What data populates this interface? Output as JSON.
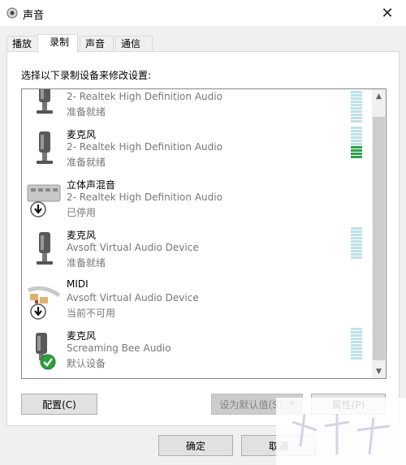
{
  "window": {
    "title": "声音",
    "close_glyph": "✕"
  },
  "tabs": [
    {
      "label": "播放",
      "active": false
    },
    {
      "label": "录制",
      "active": true
    },
    {
      "label": "声音",
      "active": false
    },
    {
      "label": "通信",
      "active": false
    }
  ],
  "instruction": "选择以下录制设备来修改设置:",
  "devices": [
    {
      "name": "",
      "description": "2- Realtek High Definition Audio",
      "status": "准备就绪",
      "icon": "microphone-icon",
      "level": 0
    },
    {
      "name": "麦克风",
      "description": "2- Realtek High Definition Audio",
      "status": "准备就绪",
      "icon": "microphone-icon",
      "level": 0.4
    },
    {
      "name": "立体声混音",
      "description": "2- Realtek High Definition Audio",
      "status": "已停用",
      "icon": "stereo-mix-icon",
      "level": null
    },
    {
      "name": "麦克风",
      "description": "Avsoft Virtual Audio Device",
      "status": "准备就绪",
      "icon": "microphone-icon",
      "level": 0
    },
    {
      "name": "MIDI",
      "description": "Avsoft Virtual Audio Device",
      "status": "当前不可用",
      "icon": "midi-connector-icon",
      "level": null
    },
    {
      "name": "麦克风",
      "description": "Screaming Bee Audio",
      "status": "默认设备",
      "icon": "microphone-icon",
      "level": 0
    }
  ],
  "buttons": {
    "configure": "配置(C)",
    "set_default": "设为默认值(S)",
    "properties": "属性(P)",
    "ok": "确定",
    "cancel": "取消"
  },
  "colors": {
    "meter_off": "#bfe0ea",
    "meter_on": "#30a04a",
    "default_badge": "#2e9e3f"
  }
}
